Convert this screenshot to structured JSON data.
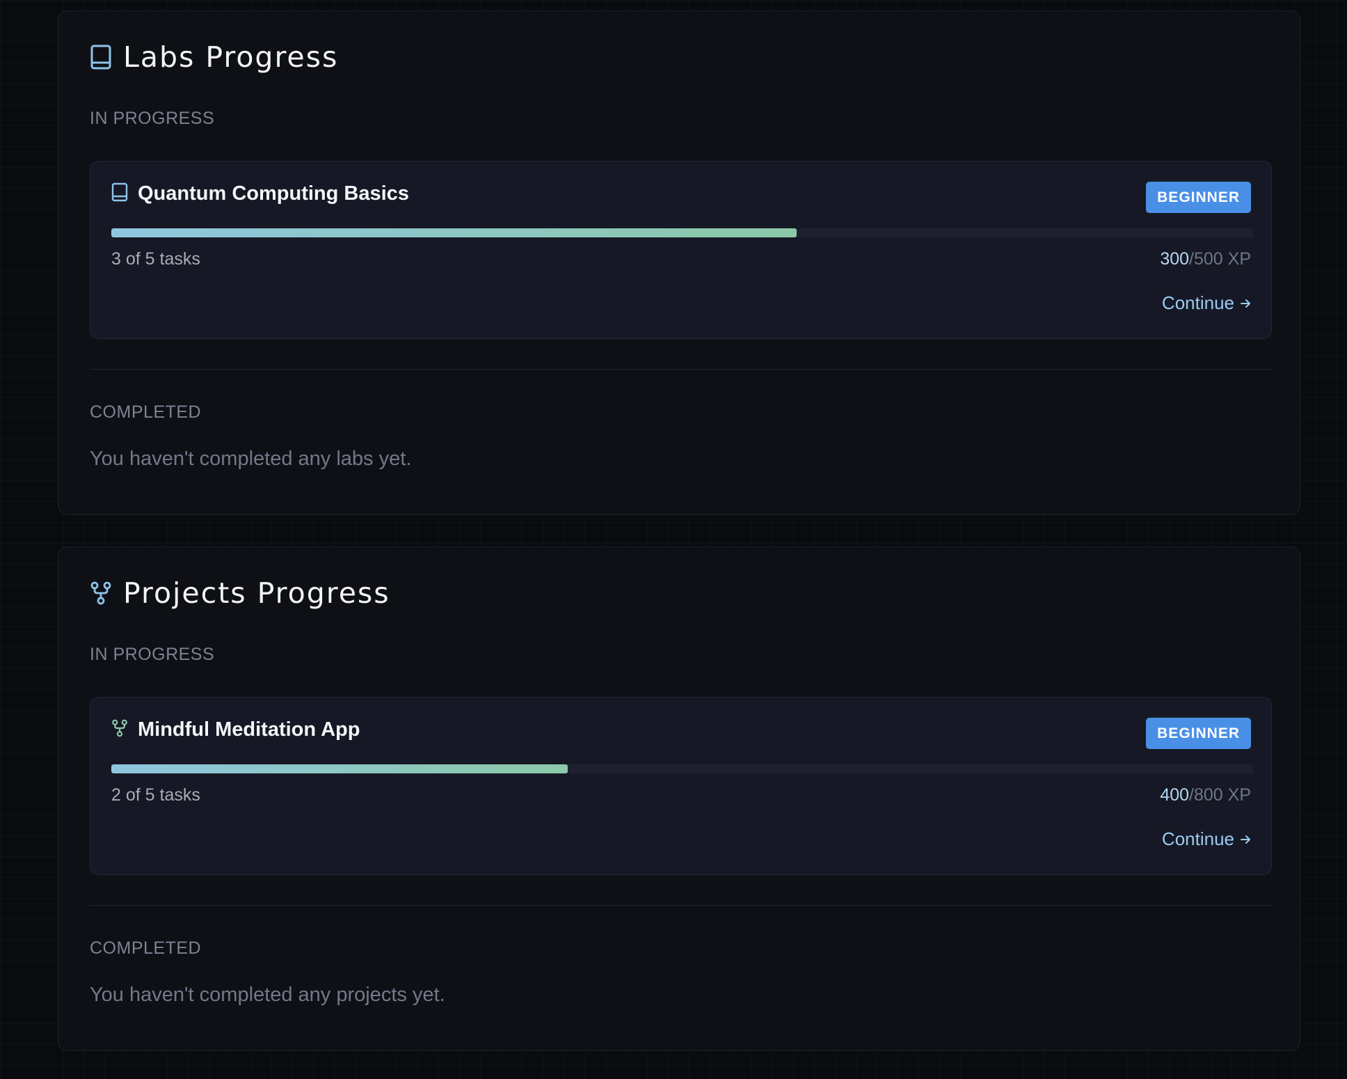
{
  "labs": {
    "title": "Labs Progress",
    "icon": "book-icon",
    "in_progress_label": "IN PROGRESS",
    "completed_label": "COMPLETED",
    "card": {
      "title": "Quantum Computing Basics",
      "icon": "book-icon",
      "badge": "BEGINNER",
      "progress_fraction": 0.6,
      "tasks_text": "3 of 5 tasks",
      "xp_current": "300",
      "xp_total": "/500 XP",
      "continue_label": "Continue",
      "continue_icon": "arrow-right-icon"
    },
    "completed_empty": "You haven't completed any labs yet."
  },
  "projects": {
    "title": "Projects Progress",
    "icon": "git-fork-icon",
    "in_progress_label": "IN PROGRESS",
    "completed_label": "COMPLETED",
    "card": {
      "title": "Mindful Meditation App",
      "icon": "git-fork-icon",
      "badge": "BEGINNER",
      "progress_fraction": 0.4,
      "tasks_text": "2 of 5 tasks",
      "xp_current": "400",
      "xp_total": "/800 XP",
      "continue_label": "Continue",
      "continue_icon": "arrow-right-icon"
    },
    "completed_empty": "You haven't completed any projects yet."
  },
  "colors": {
    "accent_blue": "#4a8fe6",
    "link": "#9ccaf2",
    "progress_start": "#8fc6df",
    "progress_end": "#8cc8a8"
  }
}
